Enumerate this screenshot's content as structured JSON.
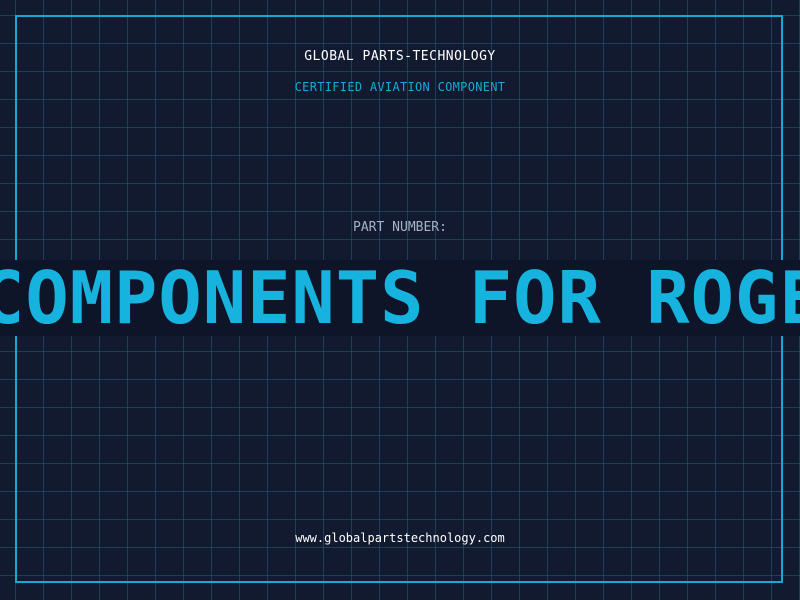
{
  "header": {
    "company_name": "GLOBAL PARTS-TECHNOLOGY",
    "certification": "CERTIFIED AVIATION COMPONENT"
  },
  "part": {
    "label": "PART NUMBER:",
    "value": "COMPONENTS FOR ROGERSON AIRCRAFT"
  },
  "footer": {
    "website": "www.globalpartstechnology.com"
  },
  "colors": {
    "background": "#121a2f",
    "grid": "#295c7c",
    "accent": "#17a9d6",
    "text_primary": "#ffffff",
    "text_muted": "#a4b3c6"
  }
}
